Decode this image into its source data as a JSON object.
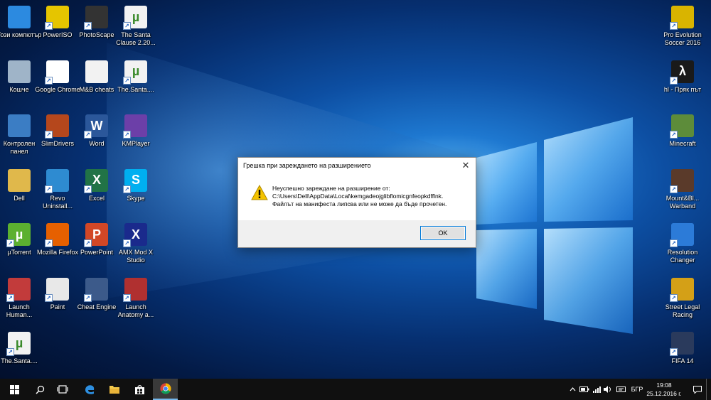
{
  "desktop_icons": [
    {
      "label": "Този компютър",
      "glyph": "",
      "color": "#2c8ae0",
      "icon": "computer-icon",
      "shortcut": false
    },
    {
      "label": "PowerISO",
      "glyph": "",
      "color": "#e5c500",
      "icon": "poweriso-icon",
      "shortcut": true
    },
    {
      "label": "PhotoScape",
      "glyph": "",
      "color": "#333333",
      "icon": "photoscape-icon",
      "shortcut": true
    },
    {
      "label": "The Santa Clause 2.20...",
      "glyph": "µ",
      "color": "#f2f2f2",
      "icon": "torrent-file-icon",
      "shortcut": true
    },
    {
      "label": "Кошче",
      "glyph": "",
      "color": "#9fb4c8",
      "icon": "recycle-bin-icon",
      "shortcut": false
    },
    {
      "label": "Google Chrome",
      "glyph": "",
      "color": "#ffffff",
      "icon": "chrome-icon",
      "shortcut": true
    },
    {
      "label": "M&B cheats",
      "glyph": "",
      "color": "#f2f2f2",
      "icon": "text-file-icon",
      "shortcut": false
    },
    {
      "label": "The.Santa....",
      "glyph": "µ",
      "color": "#f2f2f2",
      "icon": "torrent-file-icon",
      "shortcut": true
    },
    {
      "label": "Контролен панел",
      "glyph": "",
      "color": "#3b7dc4",
      "icon": "control-panel-icon",
      "shortcut": false
    },
    {
      "label": "SlimDrivers",
      "glyph": "",
      "color": "#b5471c",
      "icon": "slimdrivers-icon",
      "shortcut": true
    },
    {
      "label": "Word",
      "glyph": "W",
      "color": "#2b579a",
      "icon": "word-icon",
      "shortcut": true
    },
    {
      "label": "KMPlayer",
      "glyph": "",
      "color": "#6c3fa8",
      "icon": "kmplayer-icon",
      "shortcut": true
    },
    {
      "label": "Dell",
      "glyph": "",
      "color": "#e0b84b",
      "icon": "user-folder-icon",
      "shortcut": false
    },
    {
      "label": "Revo Uninstall...",
      "glyph": "",
      "color": "#2e8bd1",
      "icon": "revo-uninstaller-icon",
      "shortcut": true
    },
    {
      "label": "Excel",
      "glyph": "X",
      "color": "#217346",
      "icon": "excel-icon",
      "shortcut": true
    },
    {
      "label": "Skype",
      "glyph": "S",
      "color": "#00aff0",
      "icon": "skype-icon",
      "shortcut": true
    },
    {
      "label": "µTorrent",
      "glyph": "µ",
      "color": "#5cb030",
      "icon": "utorrent-icon",
      "shortcut": true
    },
    {
      "label": "Mozilla Firefox",
      "glyph": "",
      "color": "#e66000",
      "icon": "firefox-icon",
      "shortcut": true
    },
    {
      "label": "PowerPoint",
      "glyph": "P",
      "color": "#d24726",
      "icon": "powerpoint-icon",
      "shortcut": true
    },
    {
      "label": "AMX Mod X Studio",
      "glyph": "X",
      "color": "#1a2a8c",
      "icon": "amx-icon",
      "shortcut": true
    },
    {
      "label": "Launch Human...",
      "glyph": "",
      "color": "#c23b3b",
      "icon": "game-icon",
      "shortcut": true
    },
    {
      "label": "Paint",
      "glyph": "",
      "color": "#e8e8e8",
      "icon": "paint-icon",
      "shortcut": true
    },
    {
      "label": "Cheat Engine",
      "glyph": "",
      "color": "#3c5a8a",
      "icon": "cheat-engine-icon",
      "shortcut": true
    },
    {
      "label": "Launch Anatomy a...",
      "glyph": "",
      "color": "#b03030",
      "icon": "game-icon",
      "shortcut": true
    },
    {
      "label": "The.Santa....",
      "glyph": "µ",
      "color": "#f2f2f2",
      "icon": "torrent-file-icon",
      "shortcut": true
    }
  ],
  "right_icons": [
    {
      "label": "Pro Evolution Soccer 2016",
      "glyph": "",
      "color": "#d9b400",
      "icon": "pes-icon",
      "shortcut": true
    },
    {
      "label": "hl - Пряк път",
      "glyph": "λ",
      "color": "#1a1a1a",
      "icon": "half-life-icon",
      "shortcut": true
    },
    {
      "label": "Minecraft",
      "glyph": "",
      "color": "#5d8c3a",
      "icon": "minecraft-icon",
      "shortcut": true
    },
    {
      "label": "Mount&Bl... Warband",
      "glyph": "",
      "color": "#5a3a2a",
      "icon": "mount-blade-icon",
      "shortcut": true
    },
    {
      "label": "Resolution Changer",
      "glyph": "",
      "color": "#2c7bd8",
      "icon": "resolution-icon",
      "shortcut": true
    },
    {
      "label": "Street Legal Racing",
      "glyph": "",
      "color": "#d4a017",
      "icon": "car-icon",
      "shortcut": true
    },
    {
      "label": "FIFA 14",
      "glyph": "",
      "color": "#2a3a5c",
      "icon": "fifa-icon",
      "shortcut": true
    }
  ],
  "dialog": {
    "title": "Грешка при зареждането на разширението",
    "line1": "Неуспешно зареждане на разширение от:",
    "line2": "C:\\Users\\Dell\\AppData\\Local\\kemgadeojglibflomicgnfeopkdfflnk.",
    "line3": "Файлът на манифеста липсва или не може да бъде прочетен.",
    "ok": "OK",
    "close": "✕"
  },
  "taskbar": {
    "language": "БГР",
    "time": "19:08",
    "date": "25.12.2016 г."
  }
}
